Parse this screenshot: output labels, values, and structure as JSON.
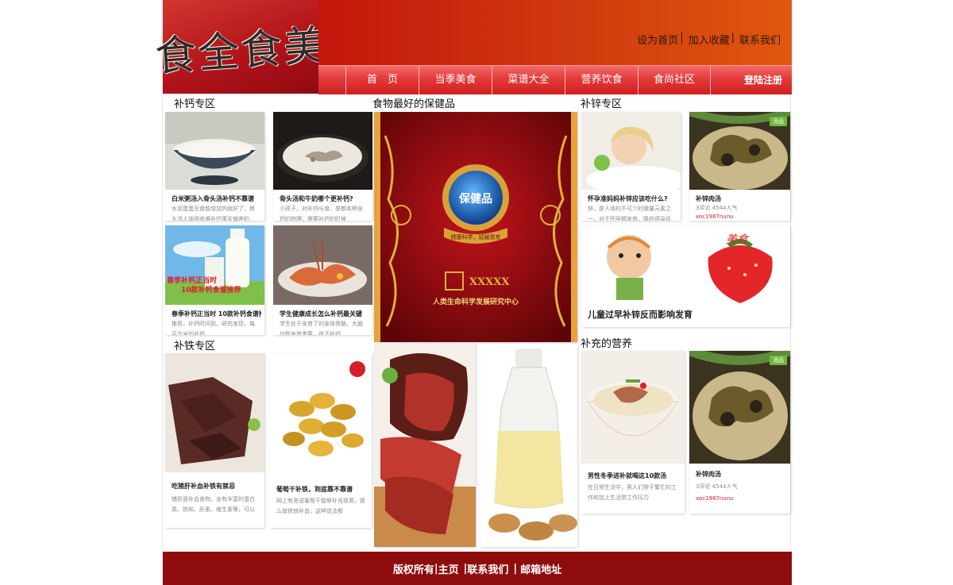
{
  "header": {
    "logo_text": "食全食美",
    "quick_links": [
      "设为首页",
      "加入收藏",
      "联系我们"
    ],
    "separator": "|",
    "nav_items": [
      "首　页",
      "当季美食",
      "菜谱大全",
      "营养饮食",
      "食尚社区"
    ],
    "login_label": "登陆注册"
  },
  "sections": {
    "calcium": "补钙专区",
    "healthcare": "食物最好的保健品",
    "zinc": "补锌专区",
    "iron": "补铁专区",
    "nutrition": "补充的营养"
  },
  "calcium_cards": [
    {
      "title": "白米粥汤入骨头汤补钙不靠谱",
      "desc": "水泥蛋蛋豆食能增加钙就好了，骨头汤人体吸收难补钙事实偏差的"
    },
    {
      "title": "骨头汤和牛奶哪个更补钙?",
      "desc": "小孩子，对补钙与食，是都各种含钙的物理，需要补钙的时候"
    },
    {
      "title": "春季补钙正当时 10款补钙食谱推荐",
      "desc": "推荐，补钙时间到，研究发现，每平方米的补钙",
      "banner1": "春季补钙正当时",
      "banner2": "10款补钙食谱推荐"
    },
    {
      "title": "学生健康成长怎么补钙最关键",
      "desc": "学生处于发育了的身体骨骼，大脑功能发育重要，孩子补钙"
    }
  ],
  "healthcare_banner": {
    "badge": "保健品",
    "ribbon": "健康科学，延缓衰老",
    "brand": "XXXXX",
    "org": "人类生命科学发展研究中心"
  },
  "zinc_cards": [
    {
      "title": "怀孕准妈妈补锌应该吃什么?",
      "desc": "锌，是人体的不可少的微量元素之一，对于怀孕期发育，降低感染风险"
    },
    {
      "title": "补锌肉汤",
      "meta": "3评论 4544人气",
      "link": "xoc1987nunu",
      "tag": "汤品"
    }
  ],
  "zinc_banner": {
    "logo": "美食",
    "caption": "儿童过早补锌反而影响发育"
  },
  "iron_cards": [
    {
      "title": "吃猪肝补血补铁有禁忌",
      "desc": "猪肝是补血食物，含有丰富的蛋白质、铁和、肝素、维生素等，可以"
    },
    {
      "title": "葡萄干补铁，到底靠不靠谱",
      "desc": "网上有答说葡萄干能够补充铁质，那么就铁就补血，这种说法都"
    }
  ],
  "nutrition_cards": [
    {
      "title": "男性冬季进补就喝这10款汤",
      "desc": "在日常生活中，男人们常于繁忙的工作和加上生活带工作压力"
    },
    {
      "title": "补锌肉汤",
      "meta": "3评论 4544人气",
      "link": "xoc1987nunu",
      "tag": "汤品"
    }
  ],
  "footer": {
    "links": [
      "版权所有",
      "主页",
      "联系我们",
      "邮箱地址"
    ],
    "separator": "|"
  },
  "colors": {
    "brand_red": "#c3160c",
    "nav_red": "#e33a3a",
    "footer_red": "#8f0c0c",
    "gold": "#e0b13a"
  }
}
